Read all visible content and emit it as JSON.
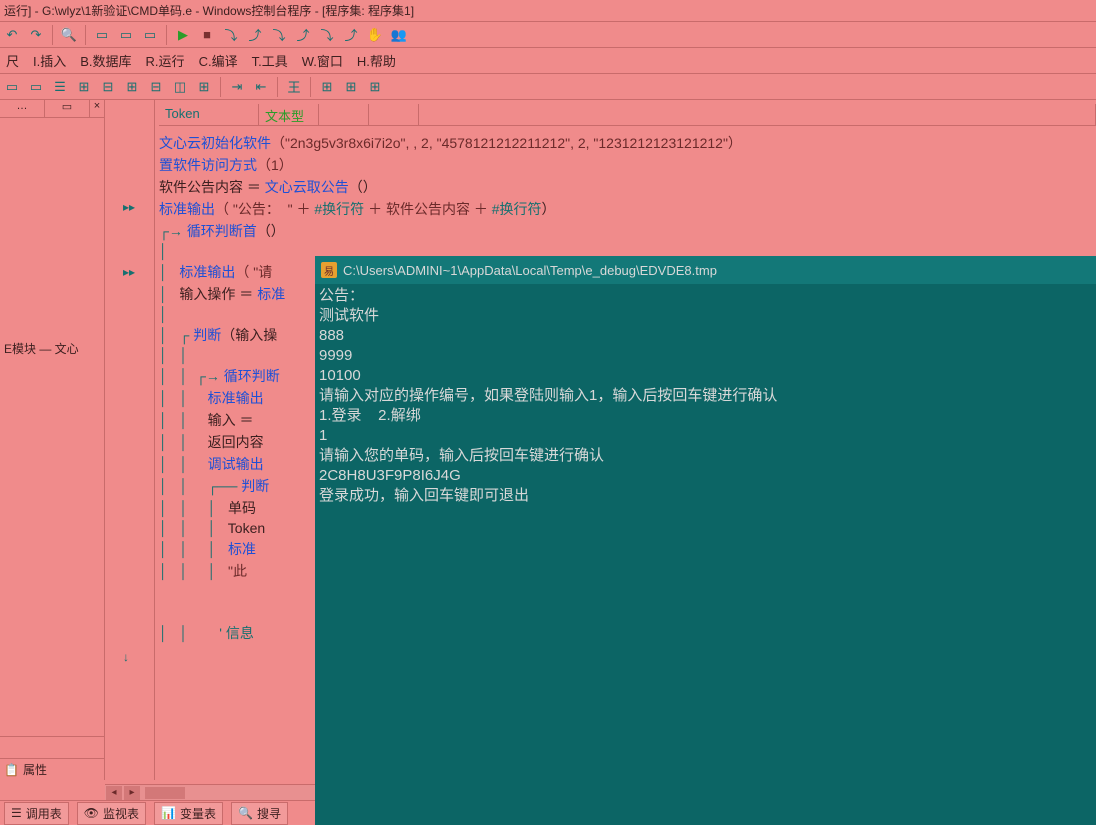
{
  "title": "运行] - G:\\wlyz\\1新验证\\CMD单码.e - Windows控制台程序 - [程序集: 程序集1]",
  "menu": {
    "r_end": "尺",
    "insert": "I.插入",
    "database": "B.数据库",
    "run": "R.运行",
    "compile": "C.编译",
    "tools": "T.工具",
    "window": "W.窗口",
    "help": "H.帮助"
  },
  "left": {
    "module": "E模块 — 文心",
    "prop_tab": "属性"
  },
  "grid": {
    "c1": "Token",
    "c2": "文本型"
  },
  "code": {
    "l1a": "文心云初始化软件",
    "l1b": "（\"2n3g5v3r8x6i7i2o\", , 2, \"4578121212211212\", 2, \"1231212123121212\"）",
    "l2a": "置软件访问方式",
    "l2b": "（1）",
    "l3a": "软件公告内容 ＝ ",
    "l3b": "文心云取公告",
    "l3c": "（）",
    "l4a": "标准输出",
    "l4b": "（ \"公告：  \" ＋ ",
    "l4c": "#换行符",
    "l4d": " ＋ 软件公告内容 ＋ ",
    "l4e": "#换行符",
    "l4f": "）",
    "l5": "循环判断首",
    "l5b": "（）",
    "l6a": "标准输出",
    "l6b": "（ \"请",
    "l7a": "输入操作 ＝ ",
    "l7b": "标准",
    "l8a": "判断",
    "l8b": "（输入操",
    "l9": "循环判断",
    "l10": "标准输出",
    "l11": "输入 ＝ ",
    "l12": "返回内容",
    "l13": "调试输出",
    "l14": "判断",
    "l15": "单码",
    "l16": "Token",
    "l17": "标准",
    "l18": "\"此",
    "l19": "' 信息"
  },
  "console": {
    "title": "C:\\Users\\ADMINI~1\\AppData\\Local\\Temp\\e_debug\\EDVDE8.tmp",
    "line1": "公告：",
    "line2": "测试软件",
    "line3": "888",
    "line4": "9999",
    "line5": "10100",
    "line6": "请输入对应的操作编号，如果登陆则输入1，输入后按回车键进行确认",
    "line7": "1.登录    2.解绑",
    "line8": "1",
    "line9": "请输入您的单码，输入后按回车键进行确认",
    "line10": "2C8H8U3F9P8I6J4G",
    "line11": "登录成功，输入回车键即可退出"
  },
  "bottom": {
    "calltable": "调用表",
    "watch": "监视表",
    "vartable": "变量表",
    "search": "搜寻"
  }
}
